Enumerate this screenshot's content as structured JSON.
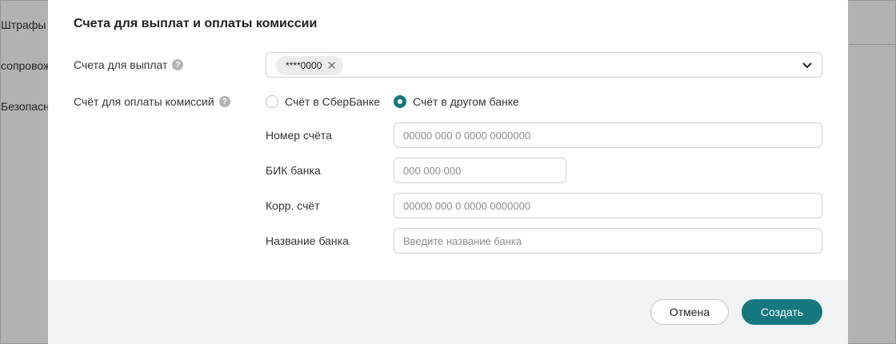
{
  "background": {
    "items": [
      "Штрафы и",
      "сопровож",
      "Безопасна"
    ]
  },
  "modal": {
    "title": "Счета для выплат и оплаты комиссии",
    "payout_label": "Счета для выплат",
    "payout_chip": "****0000",
    "commission_label": "Счёт для оплаты комиссий",
    "radio_sber": "Счёт в СберБанке",
    "radio_other": "Счёт в другом банке",
    "radio_selected": "other",
    "fields": {
      "account_label": "Номер счёта",
      "account_placeholder": "00000 000 0 0000 0000000",
      "bik_label": "БИК банка",
      "bik_placeholder": "000 000 000",
      "corr_label": "Корр. счёт",
      "corr_placeholder": "00000 000 0 0000 0000000",
      "bank_label": "Название банка",
      "bank_placeholder": "Введите название банка"
    },
    "help_glyph": "?",
    "chip_remove_glyph": "✕",
    "cancel_label": "Отмена",
    "create_label": "Создать"
  },
  "colors": {
    "accent": "#15787e",
    "footer_bg": "#f2f3f5",
    "overlay": "rgba(0,0,0,0.30)"
  },
  "icons": {
    "help": "question-circle-icon",
    "remove": "close-icon",
    "dropdown": "chevron-down-icon"
  }
}
